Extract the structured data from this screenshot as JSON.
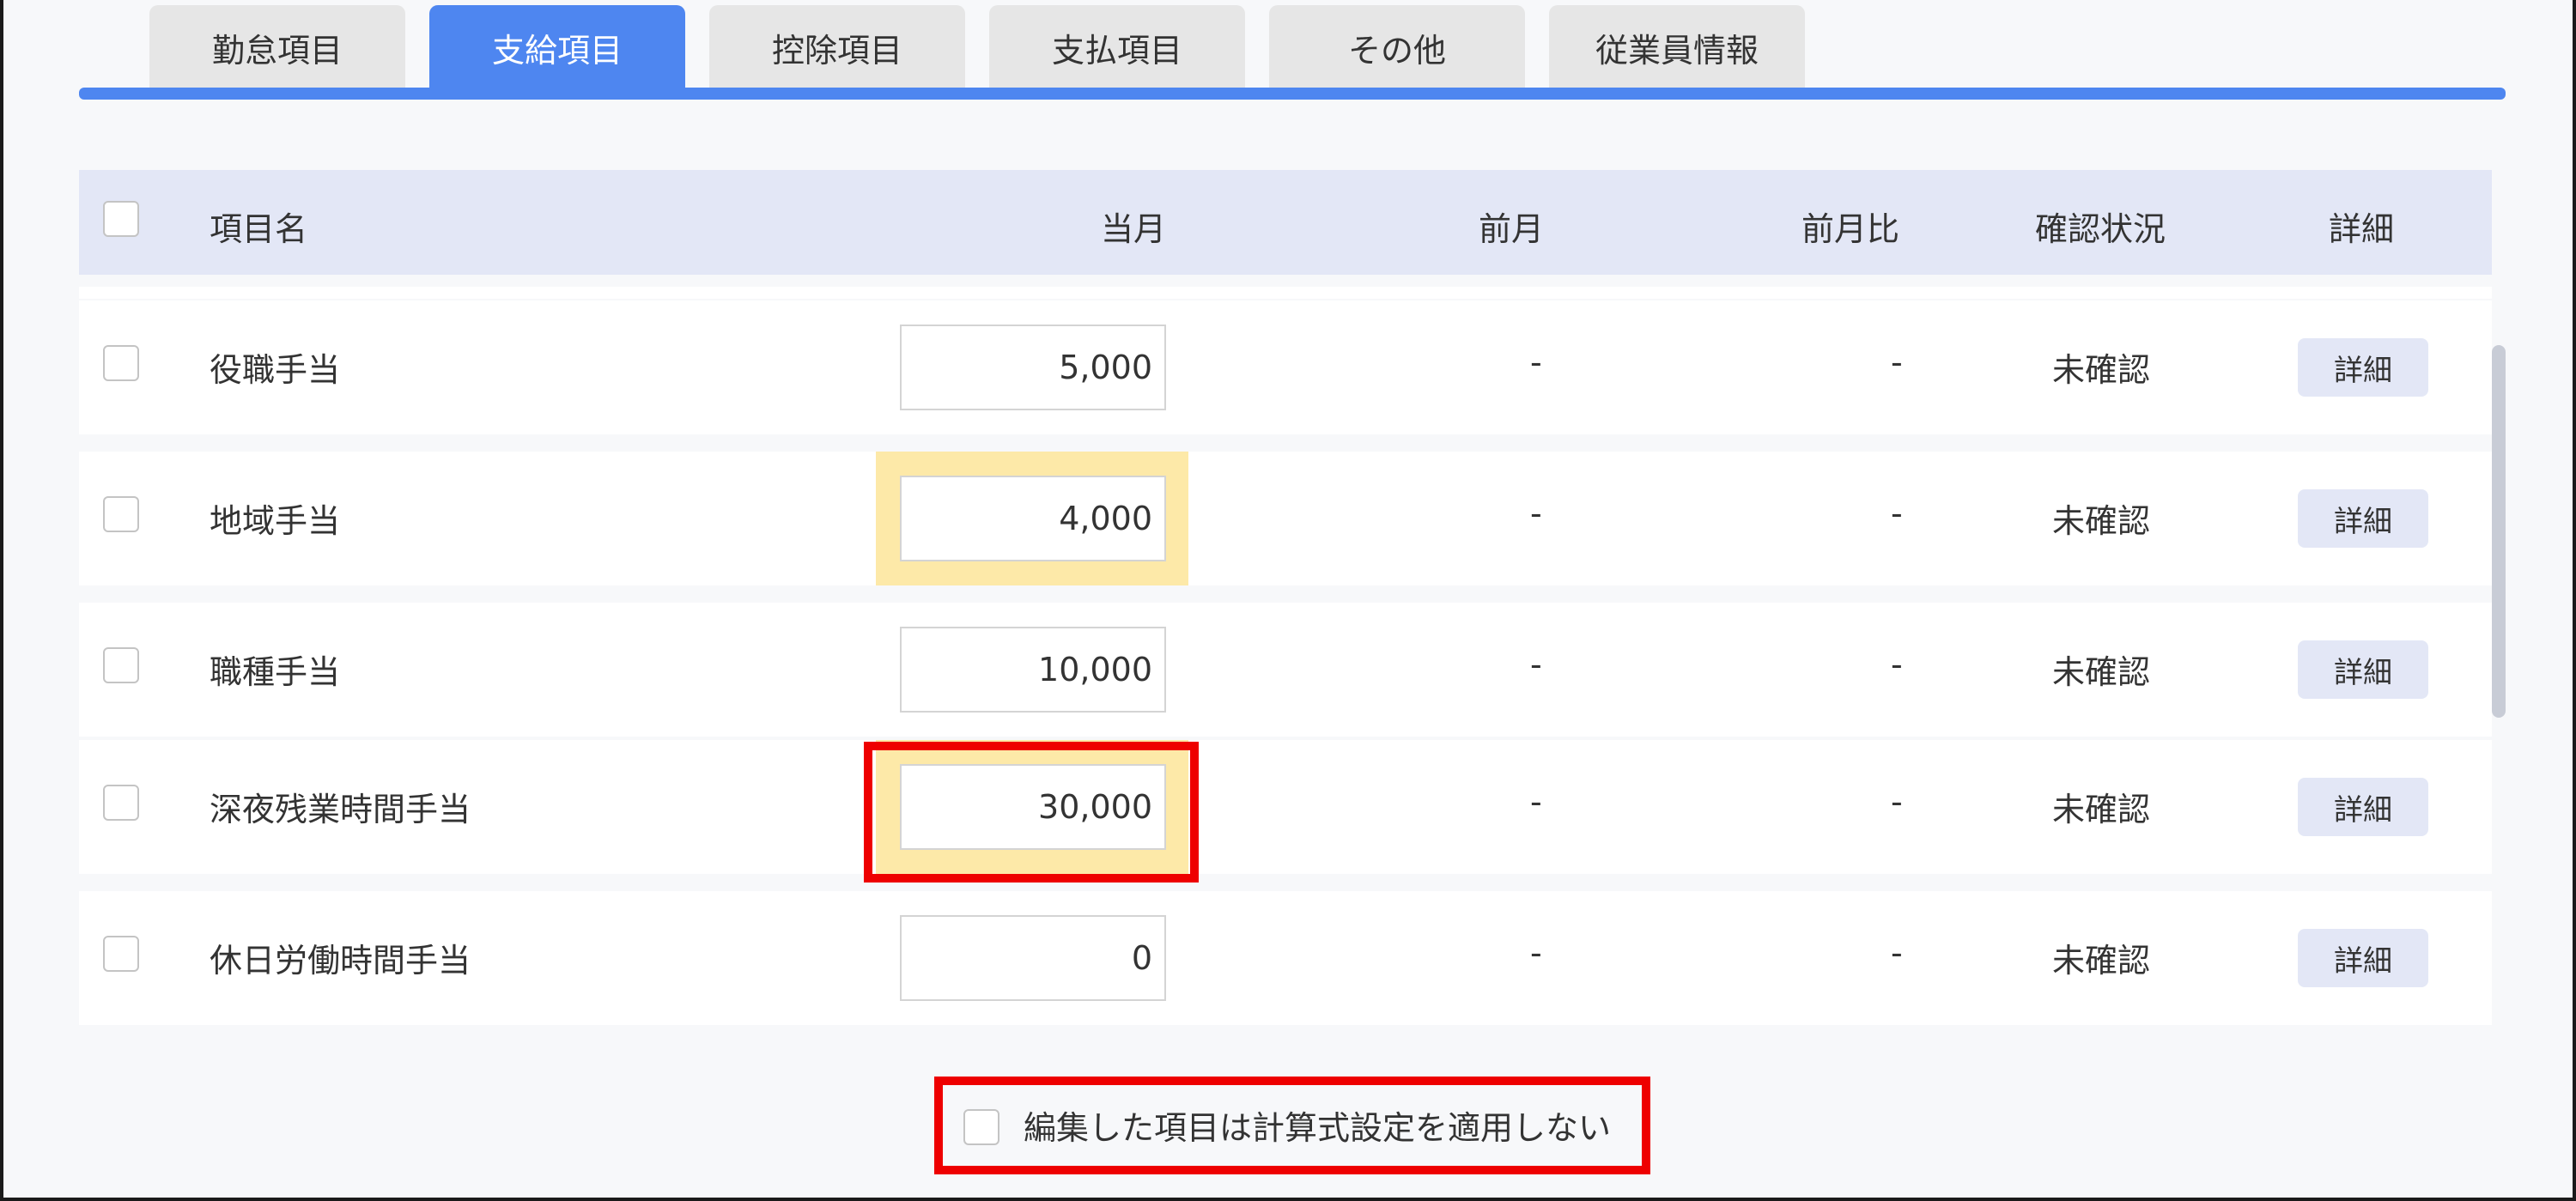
{
  "tabs": [
    {
      "label": "勤怠項目",
      "active": false
    },
    {
      "label": "支給項目",
      "active": true
    },
    {
      "label": "控除項目",
      "active": false
    },
    {
      "label": "支払項目",
      "active": false
    },
    {
      "label": "その他",
      "active": false
    },
    {
      "label": "従業員情報",
      "active": false
    }
  ],
  "table": {
    "headers": {
      "name": "項目名",
      "current": "当月",
      "previous": "前月",
      "ratio": "前月比",
      "status": "確認状況",
      "detail": "詳細"
    },
    "rows": [
      {
        "name": "役職手当",
        "current": "5,000",
        "previous": "-",
        "ratio": "-",
        "status": "未確認",
        "detail": "詳細",
        "highlighted": false
      },
      {
        "name": "地域手当",
        "current": "4,000",
        "previous": "-",
        "ratio": "-",
        "status": "未確認",
        "detail": "詳細",
        "highlighted": true
      },
      {
        "name": "職種手当",
        "current": "10,000",
        "previous": "-",
        "ratio": "-",
        "status": "未確認",
        "detail": "詳細",
        "highlighted": false
      },
      {
        "name": "深夜残業時間手当",
        "current": "30,000",
        "previous": "-",
        "ratio": "-",
        "status": "未確認",
        "detail": "詳細",
        "highlighted": true
      },
      {
        "name": "休日労働時間手当",
        "current": "0",
        "previous": "-",
        "ratio": "-",
        "status": "未確認",
        "detail": "詳細",
        "highlighted": false
      }
    ]
  },
  "footer": {
    "checkbox_label": "編集した項目は計算式設定を適用しない"
  },
  "colors": {
    "accent": "#4e86f0",
    "header_bg": "#e3e7f6",
    "highlight": "#fde9a8",
    "annotation_red": "#ee0000"
  }
}
